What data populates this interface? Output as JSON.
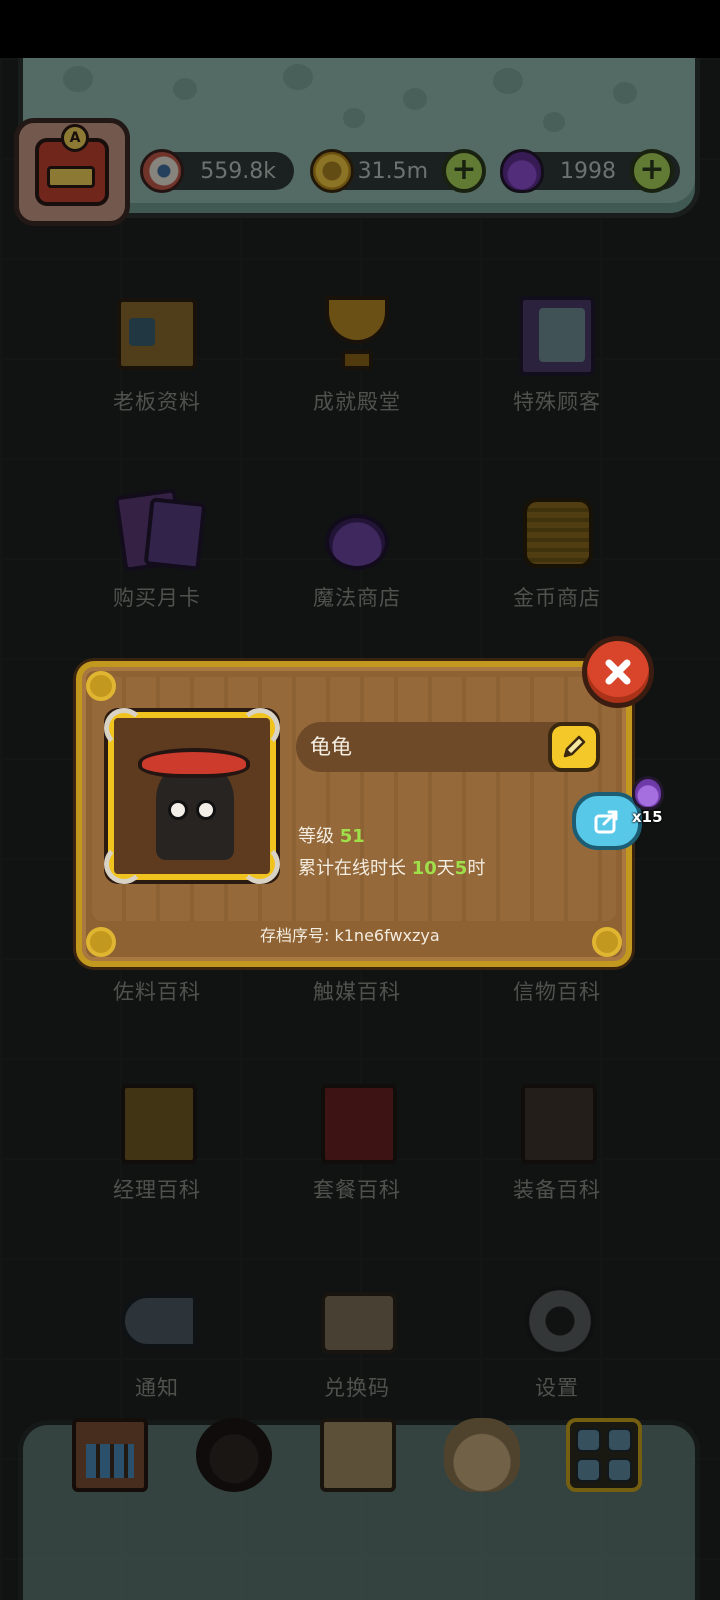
{
  "header": {
    "eyes_value": "559.8k",
    "coins_value": "31.5m",
    "potions_value": "1998",
    "avatar_letter": "A"
  },
  "menu": [
    {
      "label": "老板资料",
      "icon": "boss-card-icon"
    },
    {
      "label": "成就殿堂",
      "icon": "trophy-icon"
    },
    {
      "label": "特殊顾客",
      "icon": "customer-book-icon"
    },
    {
      "label": "购买月卡",
      "icon": "monthly-card-icon"
    },
    {
      "label": "魔法商店",
      "icon": "potion-shop-icon"
    },
    {
      "label": "金币商店",
      "icon": "coin-shop-icon"
    },
    {
      "label": "佐料百科",
      "icon": "spice-book-icon"
    },
    {
      "label": "触媒百科",
      "icon": "catalyst-book-icon"
    },
    {
      "label": "信物百科",
      "icon": "token-book-icon"
    },
    {
      "label": "经理百科",
      "icon": "manager-book-icon"
    },
    {
      "label": "套餐百科",
      "icon": "meal-book-icon"
    },
    {
      "label": "装备百科",
      "icon": "equipment-book-icon"
    },
    {
      "label": "通知",
      "icon": "horn-icon"
    },
    {
      "label": "兑换码",
      "icon": "scroll-icon"
    },
    {
      "label": "设置",
      "icon": "gear-icon"
    }
  ],
  "profile": {
    "name": "龟龟",
    "level_label": "等级",
    "level_value": "51",
    "online_label": "累计在线时长",
    "online_days": "10",
    "days_unit": "天",
    "online_hours": "5",
    "hours_unit": "时",
    "save_id_label": "存档序号: k1ne6fwxzya",
    "share_reward": "x15"
  },
  "colors": {
    "level_green": "#9fe04a",
    "popup_wood": "#8e6232",
    "popup_border": "#c2991e",
    "close_red": "#d8452a",
    "share_blue": "#58c8e8",
    "panel_teal": "#8fb8ad"
  }
}
